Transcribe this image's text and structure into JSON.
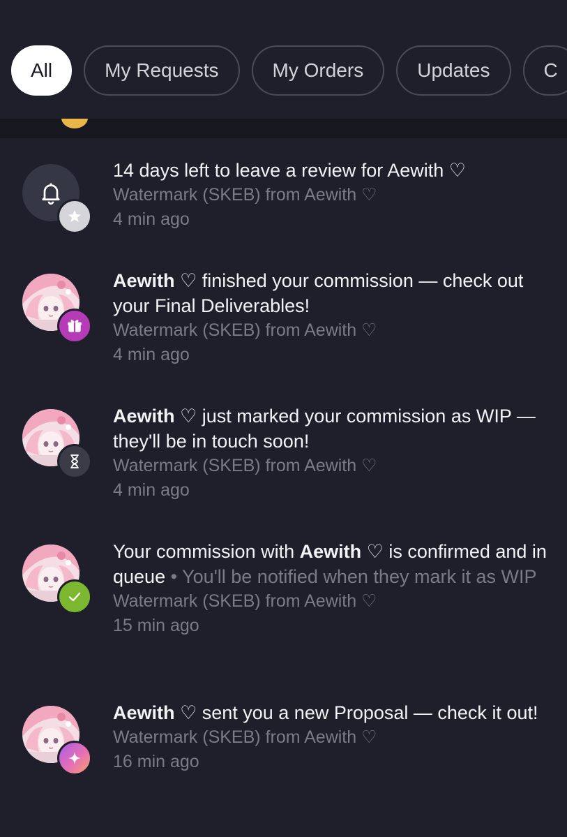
{
  "tabs": [
    {
      "label": "All",
      "active": true
    },
    {
      "label": "My Requests",
      "active": false
    },
    {
      "label": "My Orders",
      "active": false
    },
    {
      "label": "Updates",
      "active": false
    },
    {
      "label": "C",
      "active": false
    }
  ],
  "notifications": [
    {
      "icon": "bell-icon",
      "badge_icon": "star-icon",
      "badge_color": "#d4d4da",
      "title_plain": "14 days left to leave a review for Aewith ♡",
      "source": "Watermark (SKEB) from Aewith ♡",
      "time": "4 min ago"
    },
    {
      "icon": "avatar",
      "badge_icon": "gift-icon",
      "badge_color": "#b63bb7",
      "title_bold": "Aewith ♡",
      "title_rest": " finished your commission — check out your Final Deliverables!",
      "source": "Watermark (SKEB) from Aewith ♡",
      "time": "4 min ago"
    },
    {
      "icon": "avatar",
      "badge_icon": "hourglass-icon",
      "badge_color": "#3b3c48",
      "title_bold": "Aewith ♡",
      "title_rest": " just marked your commission as WIP — they'll be in touch soon!",
      "source": "Watermark (SKEB) from Aewith ♡",
      "time": "4 min ago"
    },
    {
      "icon": "avatar",
      "badge_icon": "checkmark-icon",
      "badge_color": "#7bb82f",
      "title_pre": "Your commission with ",
      "title_bold": "Aewith ♡",
      "title_rest": " is confirmed and in queue",
      "title_dim": " • You'll be notified when they mark it as WIP",
      "source": "Watermark (SKEB) from Aewith ♡",
      "time": "15 min ago"
    },
    {
      "icon": "avatar",
      "badge_icon": "sparkle-icon",
      "badge_color": "#c968d8",
      "title_bold": "Aewith ♡",
      "title_rest": " sent you a new Proposal — check it out!",
      "source": "Watermark (SKEB) from Aewith ♡",
      "time": "16 min ago"
    }
  ]
}
